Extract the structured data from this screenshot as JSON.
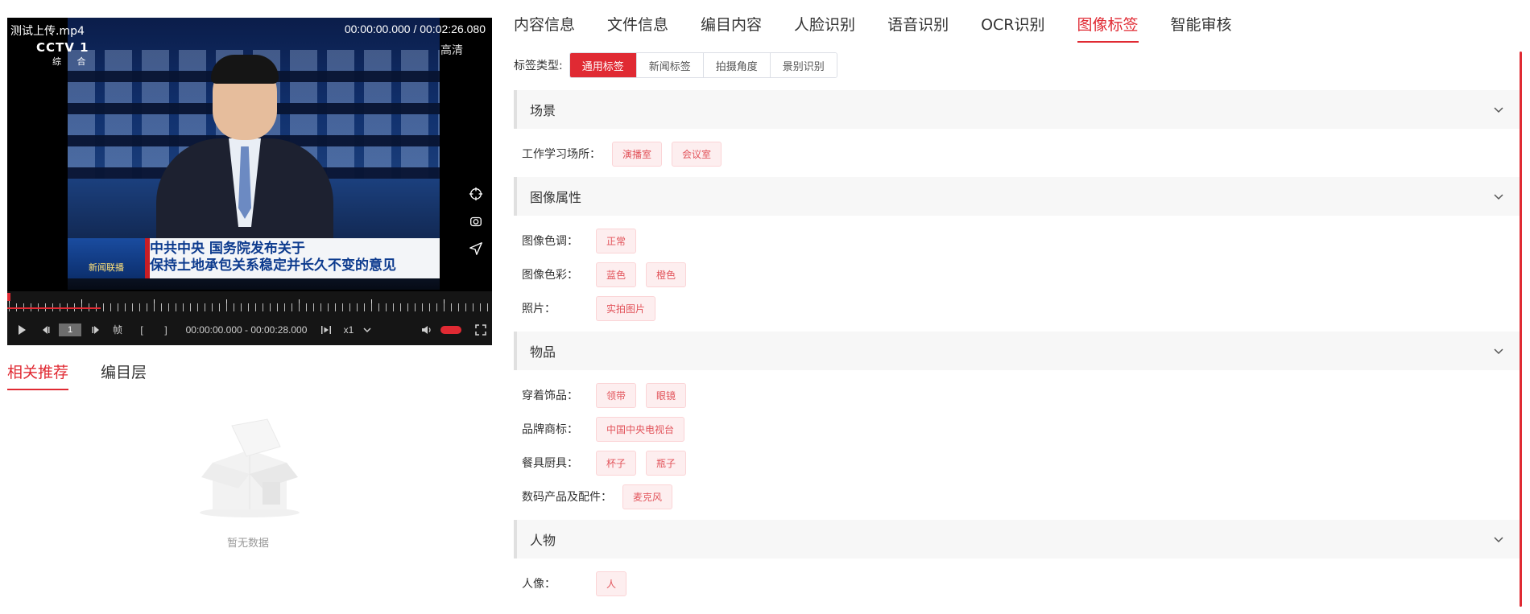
{
  "player": {
    "file_name": "测试上传.mp4",
    "time_display": "00:00:00.000 / 00:02:26.080",
    "overlay": {
      "channel_logo": "CCTV 1",
      "channel_sub": "综 合",
      "hd_badge": "高清",
      "program_logo": "新闻联播",
      "headline_line1": "中共中央 国务院发布关于",
      "headline_line2": "保持土地承包关系稳定并长久不变的意见"
    },
    "controls": {
      "frame_number": "1",
      "frame_label": "帧",
      "bracket_in": "[",
      "bracket_out": "]",
      "range_time": "00:00:00.000 - 00:00:28.000",
      "speed": "x1",
      "volume_level": 1.0
    }
  },
  "left_tabs": [
    {
      "label": "相关推荐",
      "active": true
    },
    {
      "label": "编目层",
      "active": false
    }
  ],
  "empty_state": {
    "text": "暂无数据"
  },
  "top_tabs": [
    {
      "label": "内容信息",
      "active": false
    },
    {
      "label": "文件信息",
      "active": false
    },
    {
      "label": "编目内容",
      "active": false
    },
    {
      "label": "人脸识别",
      "active": false
    },
    {
      "label": "语音识别",
      "active": false
    },
    {
      "label": "OCR识别",
      "active": false
    },
    {
      "label": "图像标签",
      "active": true
    },
    {
      "label": "智能审核",
      "active": false
    }
  ],
  "tag_type": {
    "label": "标签类型:",
    "options": [
      {
        "label": "通用标签",
        "active": true
      },
      {
        "label": "新闻标签",
        "active": false
      },
      {
        "label": "拍摄角度",
        "active": false
      },
      {
        "label": "景别识别",
        "active": false
      }
    ]
  },
  "sections": [
    {
      "title": "场景",
      "rows": [
        {
          "label": "工作学习场所：",
          "tags": [
            "演播室",
            "会议室"
          ]
        }
      ]
    },
    {
      "title": "图像属性",
      "rows": [
        {
          "label": "图像色调：",
          "tags": [
            "正常"
          ]
        },
        {
          "label": "图像色彩：",
          "tags": [
            "蓝色",
            "橙色"
          ]
        },
        {
          "label": "照片：",
          "tags": [
            "实拍图片"
          ]
        }
      ]
    },
    {
      "title": "物品",
      "rows": [
        {
          "label": "穿着饰品：",
          "tags": [
            "领带",
            "眼镜"
          ]
        },
        {
          "label": "品牌商标：",
          "tags": [
            "中国中央电视台"
          ]
        },
        {
          "label": "餐具厨具：",
          "tags": [
            "杯子",
            "瓶子"
          ]
        },
        {
          "label": "数码产品及配件：",
          "tags": [
            "麦克风"
          ]
        }
      ]
    },
    {
      "title": "人物",
      "rows": [
        {
          "label": "人像：",
          "tags": [
            "人"
          ]
        }
      ]
    }
  ],
  "colors": {
    "accent": "#e02a33",
    "tag_bg": "#fdeeef",
    "tag_text": "#e2545b"
  }
}
